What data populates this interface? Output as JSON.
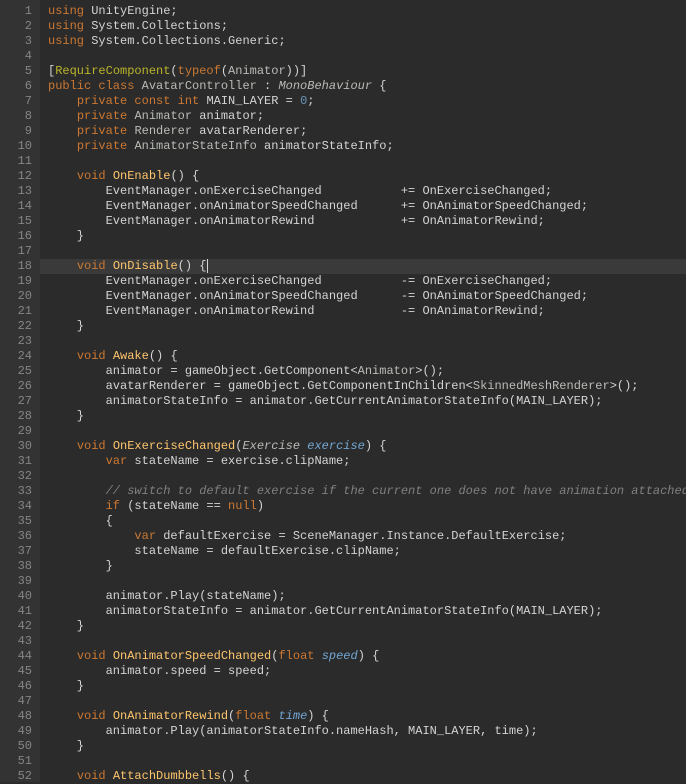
{
  "totalLines": 52,
  "activeLine": 18,
  "code": [
    [
      [
        "kw",
        "using"
      ],
      [
        "op",
        " UnityEngine;"
      ]
    ],
    [
      [
        "kw",
        "using"
      ],
      [
        "op",
        " System.Collections;"
      ]
    ],
    [
      [
        "kw",
        "using"
      ],
      [
        "op",
        " System.Collections.Generic;"
      ]
    ],
    [],
    [
      [
        "op",
        "["
      ],
      [
        "attr",
        "RequireComponent"
      ],
      [
        "op",
        "("
      ],
      [
        "kw",
        "typeof"
      ],
      [
        "op",
        "("
      ],
      [
        "class",
        "Animator"
      ],
      [
        "op",
        "))]"
      ]
    ],
    [
      [
        "kw",
        "public class"
      ],
      [
        "op",
        " "
      ],
      [
        "class",
        "AvatarController"
      ],
      [
        "op",
        " : "
      ],
      [
        "type",
        "MonoBehaviour"
      ],
      [
        "op",
        " {"
      ]
    ],
    [
      [
        "op",
        "    "
      ],
      [
        "kw",
        "private const "
      ],
      [
        "kw",
        "int"
      ],
      [
        "op",
        " MAIN_LAYER = "
      ],
      [
        "num",
        "0"
      ],
      [
        "op",
        ";"
      ]
    ],
    [
      [
        "op",
        "    "
      ],
      [
        "kw",
        "private"
      ],
      [
        "op",
        " "
      ],
      [
        "class",
        "Animator"
      ],
      [
        "op",
        " animator;"
      ]
    ],
    [
      [
        "op",
        "    "
      ],
      [
        "kw",
        "private"
      ],
      [
        "op",
        " "
      ],
      [
        "class",
        "Renderer"
      ],
      [
        "op",
        " avatarRenderer;"
      ]
    ],
    [
      [
        "op",
        "    "
      ],
      [
        "kw",
        "private"
      ],
      [
        "op",
        " "
      ],
      [
        "class",
        "AnimatorStateInfo"
      ],
      [
        "op",
        " animatorStateInfo;"
      ]
    ],
    [],
    [
      [
        "op",
        "    "
      ],
      [
        "kw",
        "void"
      ],
      [
        "op",
        " "
      ],
      [
        "method",
        "OnEnable"
      ],
      [
        "op",
        "() {"
      ]
    ],
    [
      [
        "op",
        "        EventManager.onExerciseChanged           += OnExerciseChanged;"
      ]
    ],
    [
      [
        "op",
        "        EventManager.onAnimatorSpeedChanged      += OnAnimatorSpeedChanged;"
      ]
    ],
    [
      [
        "op",
        "        EventManager.onAnimatorRewind            += OnAnimatorRewind;"
      ]
    ],
    [
      [
        "op",
        "    }"
      ]
    ],
    [],
    [
      [
        "op",
        "    "
      ],
      [
        "kw",
        "void"
      ],
      [
        "op",
        " "
      ],
      [
        "method",
        "OnDisable"
      ],
      [
        "op",
        "() {"
      ],
      [
        "cursor",
        ""
      ]
    ],
    [
      [
        "op",
        "        EventManager.onExerciseChanged           -= OnExerciseChanged;"
      ]
    ],
    [
      [
        "op",
        "        EventManager.onAnimatorSpeedChanged      -= OnAnimatorSpeedChanged;"
      ]
    ],
    [
      [
        "op",
        "        EventManager.onAnimatorRewind            -= OnAnimatorRewind;"
      ]
    ],
    [
      [
        "op",
        "    }"
      ]
    ],
    [],
    [
      [
        "op",
        "    "
      ],
      [
        "kw",
        "void"
      ],
      [
        "op",
        " "
      ],
      [
        "method",
        "Awake"
      ],
      [
        "op",
        "() {"
      ]
    ],
    [
      [
        "op",
        "        animator = gameObject.GetComponent<"
      ],
      [
        "class",
        "Animator"
      ],
      [
        "op",
        ">();"
      ]
    ],
    [
      [
        "op",
        "        avatarRenderer = gameObject.GetComponentInChildren<"
      ],
      [
        "class",
        "SkinnedMeshRenderer"
      ],
      [
        "op",
        ">();"
      ]
    ],
    [
      [
        "op",
        "        animatorStateInfo = animator.GetCurrentAnimatorStateInfo(MAIN_LAYER);"
      ]
    ],
    [
      [
        "op",
        "    }"
      ]
    ],
    [],
    [
      [
        "op",
        "    "
      ],
      [
        "kw",
        "void"
      ],
      [
        "op",
        " "
      ],
      [
        "method",
        "OnExerciseChanged"
      ],
      [
        "op",
        "("
      ],
      [
        "type",
        "Exercise"
      ],
      [
        "op",
        " "
      ],
      [
        "param",
        "exercise"
      ],
      [
        "op",
        ") {"
      ]
    ],
    [
      [
        "op",
        "        "
      ],
      [
        "kw",
        "var"
      ],
      [
        "op",
        " stateName = exercise.clipName;"
      ]
    ],
    [],
    [
      [
        "op",
        "        "
      ],
      [
        "comment",
        "// switch to default exercise if the current one does not have animation attached"
      ]
    ],
    [
      [
        "op",
        "        "
      ],
      [
        "kw",
        "if"
      ],
      [
        "op",
        " (stateName == "
      ],
      [
        "kw",
        "null"
      ],
      [
        "op",
        ")"
      ]
    ],
    [
      [
        "op",
        "        {"
      ]
    ],
    [
      [
        "op",
        "            "
      ],
      [
        "kw",
        "var"
      ],
      [
        "op",
        " defaultExercise = SceneManager.Instance.DefaultExercise;"
      ]
    ],
    [
      [
        "op",
        "            stateName = defaultExercise.clipName;"
      ]
    ],
    [
      [
        "op",
        "        }"
      ]
    ],
    [],
    [
      [
        "op",
        "        animator.Play(stateName);"
      ]
    ],
    [
      [
        "op",
        "        animatorStateInfo = animator.GetCurrentAnimatorStateInfo(MAIN_LAYER);"
      ]
    ],
    [
      [
        "op",
        "    }"
      ]
    ],
    [],
    [
      [
        "op",
        "    "
      ],
      [
        "kw",
        "void"
      ],
      [
        "op",
        " "
      ],
      [
        "method",
        "OnAnimatorSpeedChanged"
      ],
      [
        "op",
        "("
      ],
      [
        "kw",
        "float"
      ],
      [
        "op",
        " "
      ],
      [
        "param",
        "speed"
      ],
      [
        "op",
        ") {"
      ]
    ],
    [
      [
        "op",
        "        animator.speed = speed;"
      ]
    ],
    [
      [
        "op",
        "    }"
      ]
    ],
    [],
    [
      [
        "op",
        "    "
      ],
      [
        "kw",
        "void"
      ],
      [
        "op",
        " "
      ],
      [
        "method",
        "OnAnimatorRewind"
      ],
      [
        "op",
        "("
      ],
      [
        "kw",
        "float"
      ],
      [
        "op",
        " "
      ],
      [
        "param",
        "time"
      ],
      [
        "op",
        ") {"
      ]
    ],
    [
      [
        "op",
        "        animator.Play(animatorStateInfo.nameHash, MAIN_LAYER, time);"
      ]
    ],
    [
      [
        "op",
        "    }"
      ]
    ],
    [],
    [
      [
        "op",
        "    "
      ],
      [
        "kw",
        "void"
      ],
      [
        "op",
        " "
      ],
      [
        "method",
        "AttachDumbbells"
      ],
      [
        "op",
        "() {"
      ]
    ]
  ]
}
